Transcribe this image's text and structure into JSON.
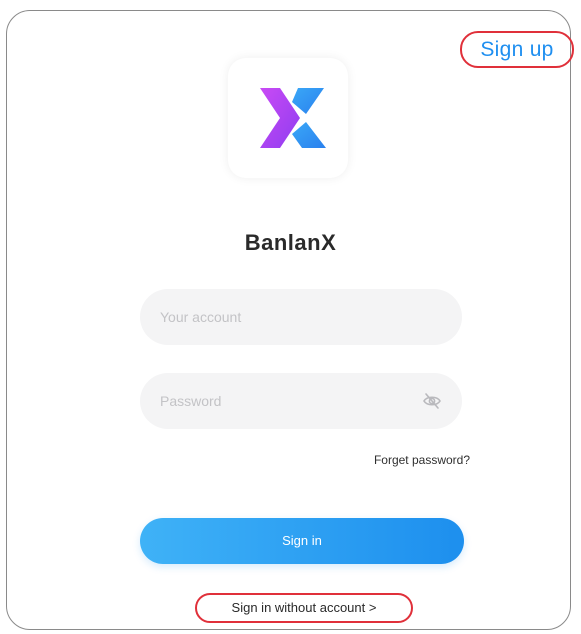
{
  "header": {
    "signup_label": "Sign up"
  },
  "logo": {
    "icon": "banlanx-logo-icon",
    "colors": {
      "purple": "#b13cf2",
      "blue": "#2f8ff2"
    }
  },
  "app": {
    "name": "BanlanX"
  },
  "form": {
    "account": {
      "value": "",
      "placeholder": "Your account"
    },
    "password": {
      "value": "",
      "placeholder": "Password",
      "toggle_icon": "eye-off-icon"
    },
    "forgot_label": "Forget password?",
    "signin_label": "Sign in",
    "guest_label": "Sign in without account >"
  },
  "colors": {
    "accent": "#1f8ff0",
    "highlight_outline": "#e0303a",
    "field_background": "#f4f4f5"
  }
}
